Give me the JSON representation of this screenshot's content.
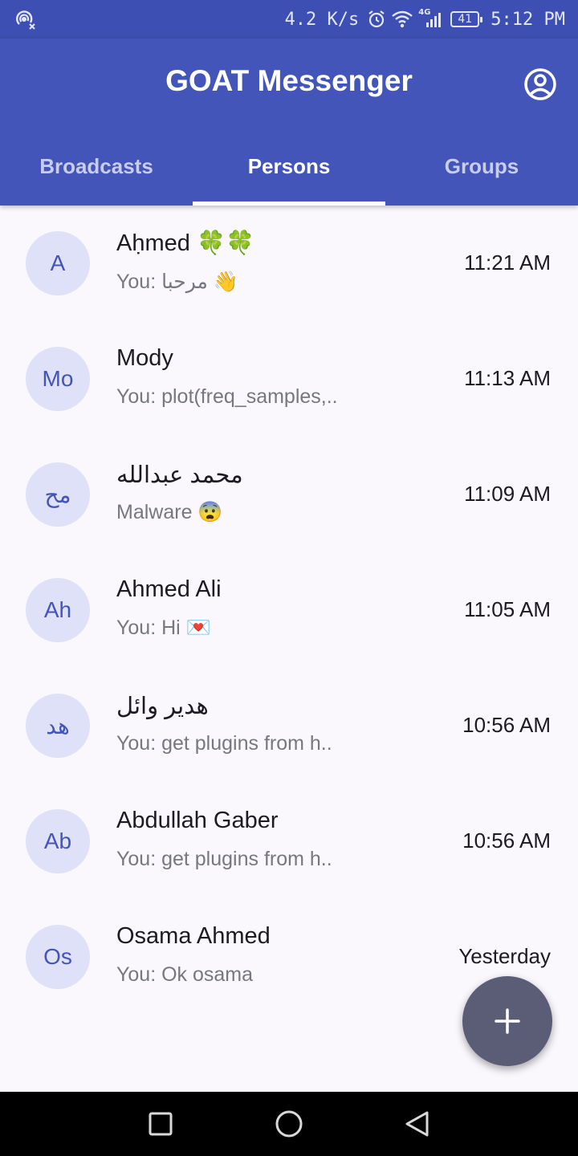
{
  "status_bar": {
    "speed": "4.2 K/s",
    "network": "4G",
    "battery": "41",
    "time": "5:12 PM",
    "icons": [
      "hotspot-icon",
      "alarm-icon",
      "wifi-icon",
      "signal-icon",
      "battery-icon"
    ]
  },
  "app_bar": {
    "title": "GOAT Messenger",
    "profile_icon": "account-circle-icon"
  },
  "tabs": [
    {
      "label": "Broadcasts",
      "active": false
    },
    {
      "label": "Persons",
      "active": true
    },
    {
      "label": "Groups",
      "active": false
    }
  ],
  "conversations": [
    {
      "initials": "A",
      "name": "Aḥmed 🍀🍀",
      "preview": "You: مرحبا 👋",
      "time": "11:21 AM"
    },
    {
      "initials": "Mo",
      "name": "Mody",
      "preview": "You: plot(freq_samples,..",
      "time": "11:13 AM"
    },
    {
      "initials": "مح",
      "name": "محمد عبدالله",
      "preview": "Malware 😨",
      "time": "11:09 AM"
    },
    {
      "initials": "Ah",
      "name": "Ahmed Ali",
      "preview": "You: Hi 💌",
      "time": "11:05 AM"
    },
    {
      "initials": "هد",
      "name": "هدير وائل",
      "preview": "You: get plugins from h..",
      "time": "10:56 AM"
    },
    {
      "initials": "Ab",
      "name": "Abdullah Gaber",
      "preview": "You: get plugins from h..",
      "time": "10:56 AM"
    },
    {
      "initials": "Os",
      "name": "Osama Ahmed",
      "preview": "You: Ok osama",
      "time": "Yesterday"
    }
  ],
  "fab": {
    "icon": "plus-icon"
  },
  "nav_bar": {
    "icons": [
      "recents-square-icon",
      "home-circle-icon",
      "back-triangle-icon"
    ]
  },
  "colors": {
    "primary": "#4355b9",
    "status_bar": "#3d4fb2",
    "avatar_bg": "#dee1f7",
    "fab": "#5a5d75",
    "background": "#fbf8fd"
  }
}
